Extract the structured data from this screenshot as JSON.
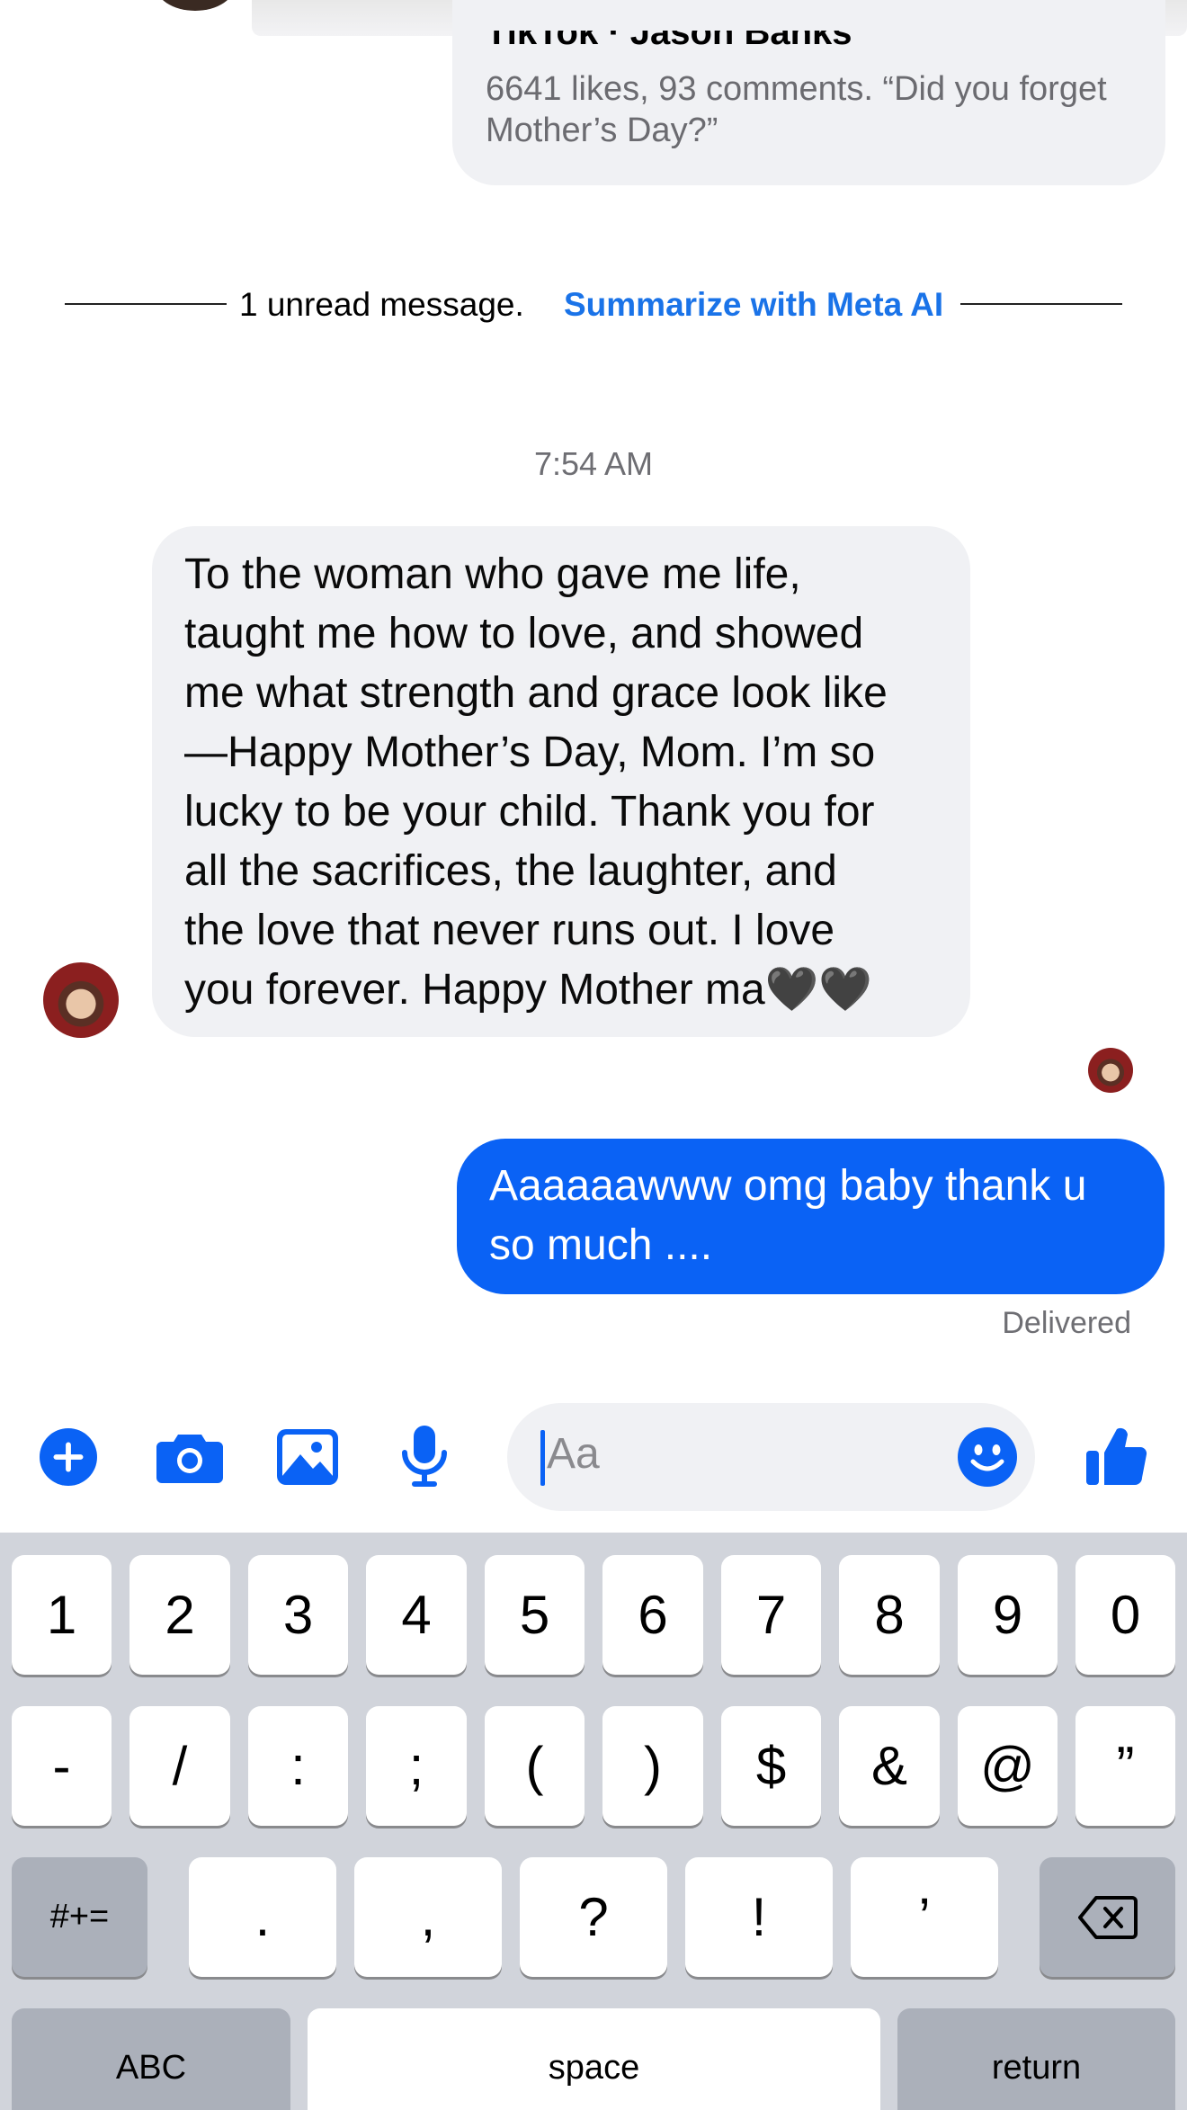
{
  "shared_link": {
    "title": "TikTok · Jason Banks",
    "meta": "6641 likes, 93 comments. “Did you forget Mother’s Day?”"
  },
  "unread_divider": {
    "text": "1 unread message.",
    "action": "Summarize with Meta AI"
  },
  "timestamp": "7:54 AM",
  "incoming_message": {
    "lines": [
      "To the woman who gave me life,",
      "taught me how to love, and showed",
      "me what strength and grace look like",
      "—Happy Mother’s Day, Mom. I’m so",
      "lucky to be your child. Thank you for",
      "all the sacrifices, the laughter, and",
      "the love that never runs out. I love",
      "you forever. Happy Mother ma🖤🖤"
    ]
  },
  "outgoing_message": {
    "lines": [
      "Aaaaaawww omg baby thank u",
      "so much ...."
    ],
    "status": "Delivered"
  },
  "composer": {
    "placeholder": "Aa",
    "icons": [
      "plus-icon",
      "camera-icon",
      "photo-icon",
      "microphone-icon",
      "emoji-icon",
      "thumbs-up-icon"
    ],
    "accent_color": "#0a62f5"
  },
  "keyboard": {
    "row1": [
      "1",
      "2",
      "3",
      "4",
      "5",
      "6",
      "7",
      "8",
      "9",
      "0"
    ],
    "row2": [
      "-",
      "/",
      ":",
      ";",
      "(",
      ")",
      "$",
      "&",
      "@",
      "”"
    ],
    "row3_left": "#+=",
    "row3": [
      ".",
      ",",
      "?",
      "!",
      "’"
    ],
    "abc": "ABC",
    "space": "space",
    "return": "return"
  }
}
